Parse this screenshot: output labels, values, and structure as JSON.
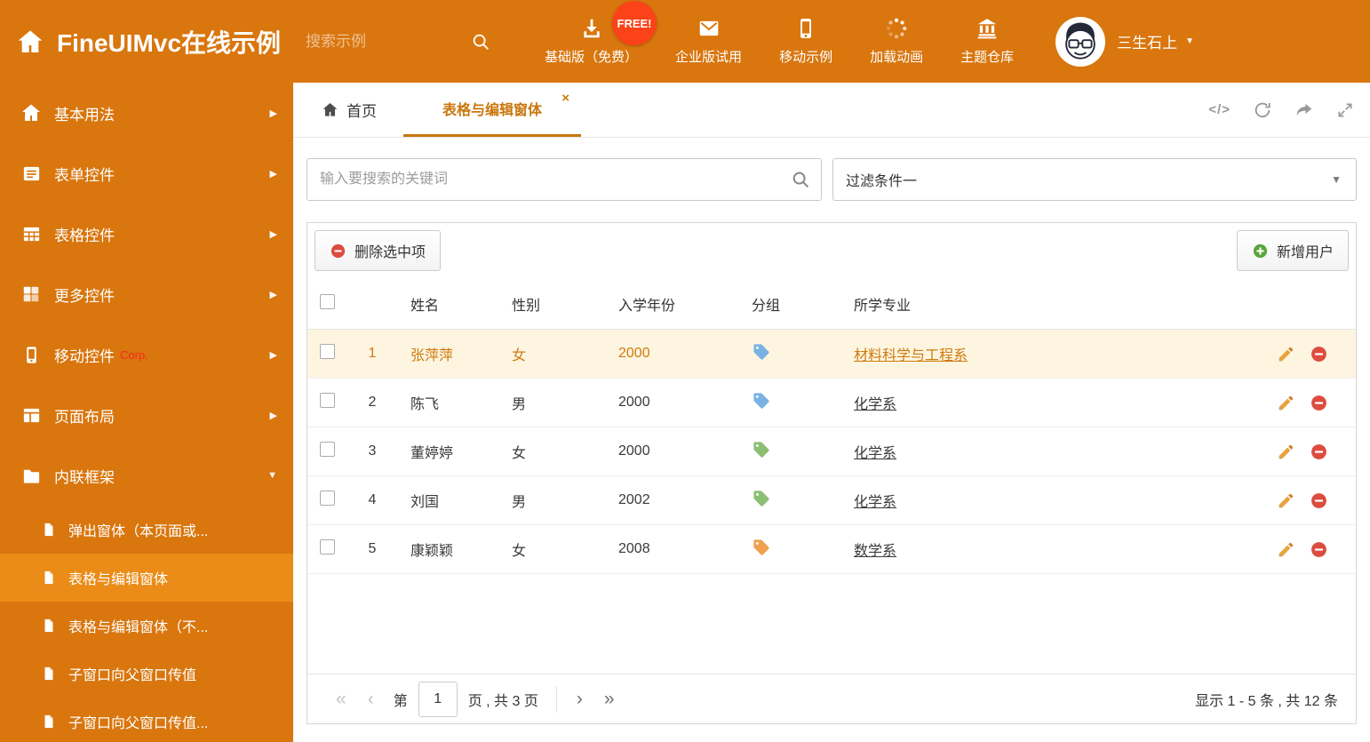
{
  "colors": {
    "orange": "#d9760e",
    "orange_selected": "#ea8c17",
    "accent_text": "#c9770e",
    "free_badge_bg": "#fb4218",
    "red": "#dc4c3f",
    "green": "#5aa63e",
    "selected_row_bg": "#fdf5e0",
    "tag_colors": {
      "blue": "#79b2e2",
      "green": "#8cbf72",
      "orange": "#f0a150"
    }
  },
  "header": {
    "title": "FineUIMvc在线示例",
    "search_placeholder": "搜索示例",
    "free_badge": "FREE!",
    "nav_items": [
      {
        "id": "basic-free",
        "icon": "download-icon",
        "label": "基础版（免费）"
      },
      {
        "id": "enterprise-trial",
        "icon": "envelope-icon",
        "label": "企业版试用"
      },
      {
        "id": "mobile-demo",
        "icon": "mobile-icon",
        "label": "移动示例"
      },
      {
        "id": "loading-anim",
        "icon": "spinner-icon",
        "label": "加载动画"
      },
      {
        "id": "theme-repo",
        "icon": "bank-icon",
        "label": "主题仓库"
      }
    ],
    "username": "三生石上"
  },
  "sidebar": {
    "items": [
      {
        "id": "basic-usage",
        "icon": "home2-icon",
        "label": "基本用法"
      },
      {
        "id": "form-controls",
        "icon": "form-icon",
        "label": "表单控件"
      },
      {
        "id": "table-controls",
        "icon": "table-icon",
        "label": "表格控件"
      },
      {
        "id": "more-controls",
        "icon": "widgets-icon",
        "label": "更多控件"
      },
      {
        "id": "mobile-controls",
        "icon": "mobile2-icon",
        "label": "移动控件",
        "badge": "Corp."
      },
      {
        "id": "page-layout",
        "icon": "layout-icon",
        "label": "页面布局"
      },
      {
        "id": "inline-frame",
        "icon": "frame-icon",
        "label": "内联框架",
        "expanded": true
      }
    ],
    "subitems": [
      {
        "id": "popup-window",
        "label": "弹出窗体（本页面或..."
      },
      {
        "id": "grid-edit-window",
        "label": "表格与编辑窗体",
        "selected": true
      },
      {
        "id": "grid-edit-window-no",
        "label": "表格与编辑窗体（不..."
      },
      {
        "id": "child-to-parent",
        "label": "子窗口向父窗口传值"
      },
      {
        "id": "child-to-parent-2",
        "label": "子窗口向父窗口传值..."
      }
    ]
  },
  "tabbar": {
    "home_tab": "首页",
    "active_tab": "表格与编辑窗体",
    "close": "×",
    "code_icon_text": "</>"
  },
  "filter": {
    "search_placeholder": "输入要搜索的关键词",
    "dropdown_value": "过滤条件一"
  },
  "toolbar": {
    "delete_label": "删除选中项",
    "add_label": "新增用户"
  },
  "grid": {
    "headers": {
      "name": "姓名",
      "gender": "性别",
      "year": "入学年份",
      "group": "分组",
      "major": "所学专业"
    },
    "rows": [
      {
        "num": "1",
        "name": "张萍萍",
        "gender": "女",
        "year": "2000",
        "tag": "blue",
        "major": "材料科学与工程系",
        "selected": true
      },
      {
        "num": "2",
        "name": "陈飞",
        "gender": "男",
        "year": "2000",
        "tag": "blue",
        "major": "化学系"
      },
      {
        "num": "3",
        "name": "董婷婷",
        "gender": "女",
        "year": "2000",
        "tag": "green",
        "major": "化学系"
      },
      {
        "num": "4",
        "name": "刘国",
        "gender": "男",
        "year": "2002",
        "tag": "green",
        "major": "化学系"
      },
      {
        "num": "5",
        "name": "康颖颖",
        "gender": "女",
        "year": "2008",
        "tag": "orange",
        "major": "数学系"
      }
    ]
  },
  "pagination": {
    "page_label_prefix": "第",
    "page_value": "1",
    "page_label_suffix": "页 , 共 3 页",
    "summary": "显示 1 - 5 条 , 共 12 条"
  }
}
